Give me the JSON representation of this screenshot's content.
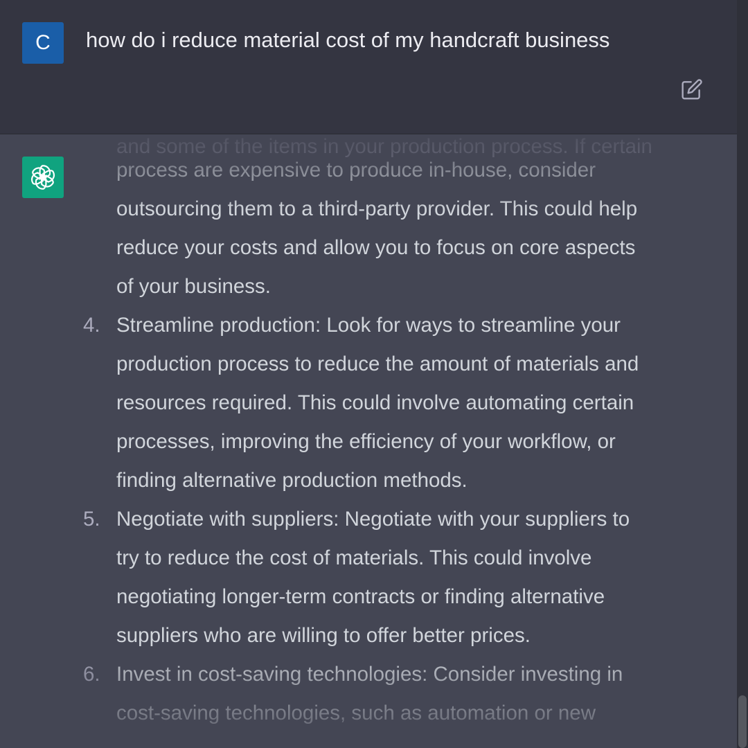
{
  "user_message": {
    "avatar_letter": "C",
    "text": "how do i reduce material cost of my handcraft business"
  },
  "edit_icon": "edit-icon",
  "assistant": {
    "avatar_icon": "openai-logo-icon",
    "lines": [
      "process are expensive to produce in-house, consider",
      "outsourcing them to a third-party provider. This could help",
      "reduce your costs and allow you to focus on core aspects",
      "of your business.",
      "Streamline production: Look for ways to streamline your",
      "production process to reduce the amount of materials and",
      "resources required. This could involve automating certain",
      "processes, improving the efficiency of your workflow, or",
      "finding alternative production methods.",
      "Negotiate with suppliers: Negotiate with your suppliers to",
      "try to reduce the cost of materials. This could involve",
      "negotiating longer-term contracts or finding alternative",
      "suppliers who are willing to offer better prices.",
      "Invest in cost-saving technologies: Consider investing in",
      "cost-saving technologies, such as automation or new"
    ],
    "numbers": {
      "item4": "4.",
      "item5": "5.",
      "item6": "6."
    }
  },
  "colors": {
    "user_bg": "#343541",
    "assistant_bg": "#444654",
    "user_avatar": "#1a5ea8",
    "bot_avatar": "#10a37f",
    "text": "#d1d5db"
  }
}
